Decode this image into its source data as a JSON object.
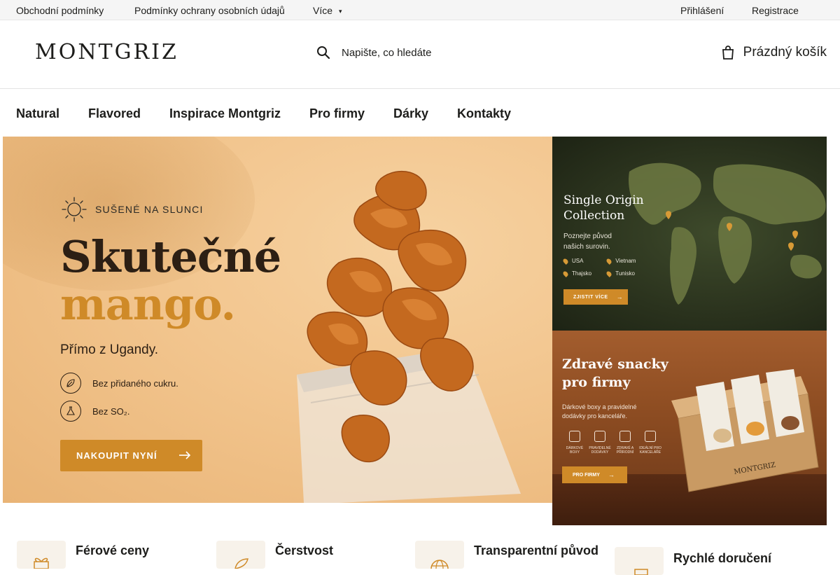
{
  "topbar": {
    "links": [
      "Obchodní podmínky",
      "Podmínky ochrany osobních údajů",
      "Více"
    ],
    "login": "Přihlášení",
    "register": "Registrace"
  },
  "header": {
    "logo": "MONTGRIZ",
    "search_placeholder": "Napište, co hledáte",
    "cart_label": "Prázdný košík"
  },
  "nav": {
    "items": [
      "Natural",
      "Flavored",
      "Inspirace Montgriz",
      "Pro firmy",
      "Dárky",
      "Kontakty"
    ]
  },
  "hero": {
    "tag": "SUŠENÉ NA SLUNCI",
    "title_line1": "Skutečné",
    "title_line2": "mango.",
    "subtitle": "Přímo z Ugandy.",
    "feature1": "Bez přidaného cukru.",
    "feature2": "Bez SO₂.",
    "cta": "NAKOUPIT NYNÍ"
  },
  "promo_origin": {
    "title_line1": "Single Origin",
    "title_line2": "Collection",
    "subtitle_line1": "Poznejte původ",
    "subtitle_line2": "našich surovin.",
    "countries": [
      "USA",
      "Vietnam",
      "Thajsko",
      "Tunisko"
    ],
    "cta": "ZJISTIT VÍCE"
  },
  "promo_business": {
    "title_line1": "Zdravé snacky",
    "title_line2": "pro firmy",
    "subtitle_line1": "Dárkové boxy a pravidelné",
    "subtitle_line2": "dodávky pro kanceláře.",
    "icons": [
      "DÁRKOVÉ BOXY",
      "PRAVIDELNÉ DODÁVKY",
      "ZDRAVÉ A PŘÍRODNÍ",
      "IDEÁLNÍ PRO KANCELÁŘE"
    ],
    "cta": "PRO FIRMY"
  },
  "benefits": [
    "Férové ceny",
    "Čerstvost",
    "Transparentní původ",
    "Rychlé doručení"
  ],
  "colors": {
    "accent": "#cf8a28",
    "text": "#1d1d1b",
    "origin_bg": "#2a321d",
    "biz_bg": "#8e4d22"
  }
}
